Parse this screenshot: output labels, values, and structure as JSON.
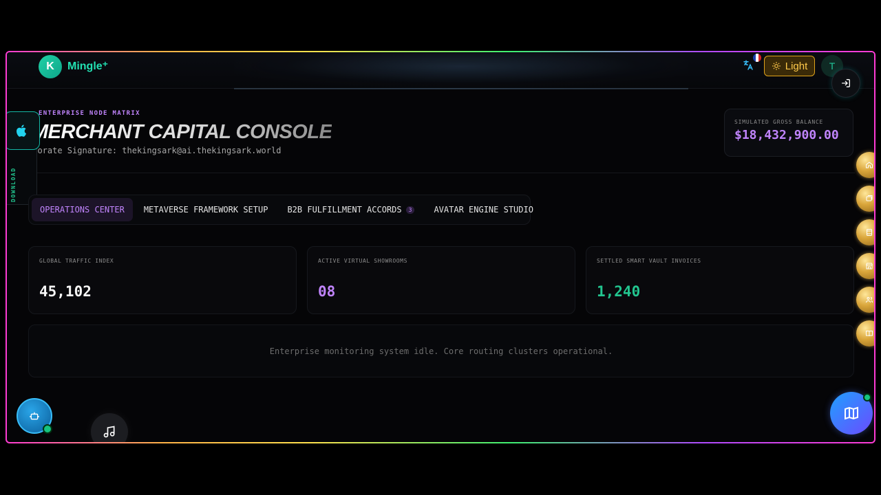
{
  "header": {
    "logo_letter": "K",
    "brand": "Mingle⁺",
    "theme_label": "Light",
    "avatar_letter": "T"
  },
  "hero": {
    "eyebrow": "ENTERPRISE NODE MATRIX",
    "title": "MERCHANT CAPITAL CONSOLE",
    "signature": "rporate Signature: thekingsark@ai.thekingsark.world"
  },
  "balance": {
    "label": "SIMULATED GROSS BALANCE",
    "value": "$18,432,900.00"
  },
  "download_rail": {
    "label": "DOWNLOAD"
  },
  "tabs": [
    {
      "label": "OPERATIONS CENTER",
      "active": true
    },
    {
      "label": "METAVERSE FRAMEWORK SETUP",
      "active": false
    },
    {
      "label": "B2B FULFILLMENT ACCORDS",
      "badge": "3",
      "active": false
    },
    {
      "label": "AVATAR ENGINE STUDIO",
      "active": false
    }
  ],
  "stats": [
    {
      "label": "GLOBAL TRAFFIC INDEX",
      "value": "45,102",
      "color": "#f5f5f5"
    },
    {
      "label": "ACTIVE VIRTUAL SHOWROOMS",
      "value": "08",
      "color": "#c084fc"
    },
    {
      "label": "SETTLED SMART VAULT INVOICES",
      "value": "1,240",
      "color": "#22c58f"
    }
  ],
  "status_message": "Enterprise monitoring system idle. Core routing clusters operational.",
  "side_nav_icons": [
    "home-icon",
    "cards-icon",
    "film-icon",
    "storefront-icon",
    "users-icon",
    "book-icon"
  ],
  "colors": {
    "accent_purple": "#c084fc",
    "accent_teal": "#22e0b2",
    "accent_gold": "#e0a31a",
    "accent_green": "#22c58f"
  }
}
